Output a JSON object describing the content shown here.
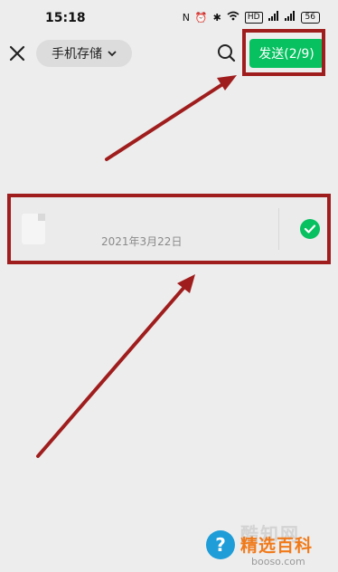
{
  "status_bar": {
    "time": "15:18",
    "icons": [
      "nfc-icon",
      "alarm-icon",
      "bluetooth-icon",
      "wifi-icon",
      "hd-icon",
      "signal-icon",
      "signal-icon-2"
    ],
    "hd_label": "HD",
    "signal_label_1": "5G",
    "signal_label_2": "4G",
    "battery": "56"
  },
  "top_bar": {
    "storage_label": "手机存储",
    "send_label": "发送(2/9)"
  },
  "file_item": {
    "date": "2021年3月22日",
    "selected": true
  },
  "watermark": {
    "faded_text": "酷知网",
    "title": "精选百科",
    "url": "booso.com"
  },
  "colors": {
    "accent": "#07c160",
    "annotation": "#a01d1d",
    "background": "#ededed"
  }
}
